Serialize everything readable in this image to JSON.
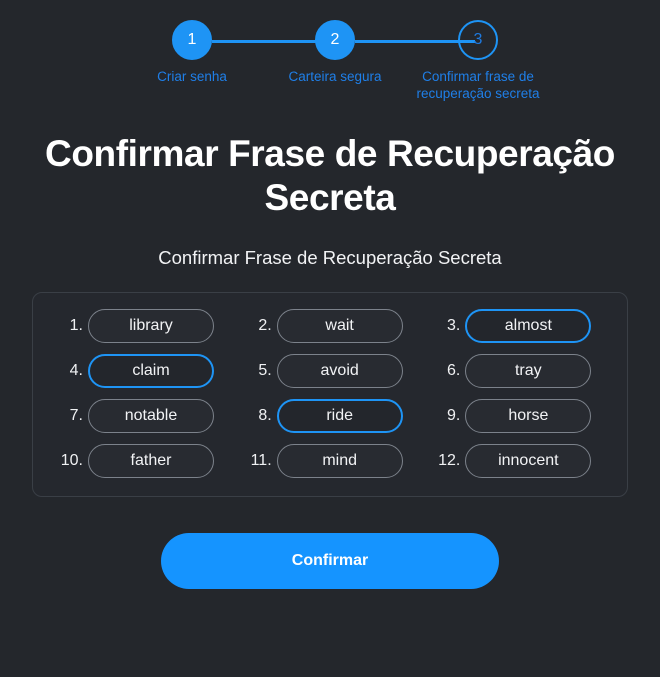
{
  "stepper": {
    "steps": [
      {
        "number": "1",
        "label": "Criar senha",
        "state": "complete"
      },
      {
        "number": "2",
        "label": "Carteira segura",
        "state": "complete"
      },
      {
        "number": "3",
        "label": "Confirmar frase de recuperação secreta",
        "state": "current"
      }
    ],
    "accent_color": "#1e94f5",
    "label_color": "#1f7fe8"
  },
  "main": {
    "title": "Confirmar Frase de Recuperação Secreta",
    "subtitle": "Confirmar Frase de Recuperação Secreta"
  },
  "word_card": {
    "words": [
      {
        "index": "1.",
        "word": "library",
        "selected": false
      },
      {
        "index": "2.",
        "word": "wait",
        "selected": false
      },
      {
        "index": "3.",
        "word": "almost",
        "selected": true
      },
      {
        "index": "4.",
        "word": "claim",
        "selected": true
      },
      {
        "index": "5.",
        "word": "avoid",
        "selected": false
      },
      {
        "index": "6.",
        "word": "tray",
        "selected": false
      },
      {
        "index": "7.",
        "word": "notable",
        "selected": false
      },
      {
        "index": "8.",
        "word": "ride",
        "selected": true
      },
      {
        "index": "9.",
        "word": "horse",
        "selected": false
      },
      {
        "index": "10.",
        "word": "father",
        "selected": false
      },
      {
        "index": "11.",
        "word": "mind",
        "selected": false
      },
      {
        "index": "12.",
        "word": "innocent",
        "selected": false
      }
    ]
  },
  "footer": {
    "confirm_label": "Confirmar",
    "confirm_color": "#1594ff"
  },
  "theme": {
    "background": "#24272c",
    "card_background": "#25282e",
    "card_border": "#3a3f46",
    "chip_border": "#7c828b",
    "chip_border_selected": "#1e94f5",
    "text": "#ffffff"
  }
}
